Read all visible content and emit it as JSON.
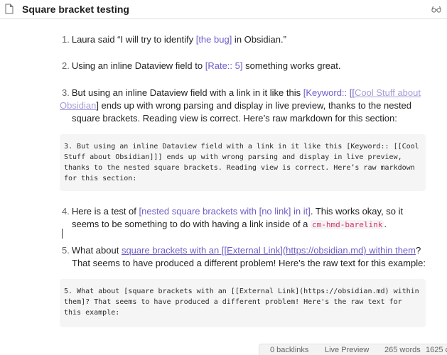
{
  "header": {
    "title": "Square bracket testing",
    "doc_icon": "file-icon",
    "mode_icon": "reading-glasses-icon"
  },
  "items": [
    {
      "num": "1.",
      "before": "Laura said “I will try to identify ",
      "tag": "[the bug]",
      "after": " in Obsidian.”"
    },
    {
      "num": "2.",
      "before": "Using an inline Dataview field to ",
      "tag": "[Rate:: 5]",
      "after": " something works great."
    },
    {
      "num": "3.",
      "line1_before": "But using an inline Dataview field with a link in it like this ",
      "line1_tag": "[Keyword:: [[",
      "line1_link": "Cool Stuff about",
      "line2_link": "Obsidian",
      "line2_after": "] ends up with wrong parsing and display in live preview, thanks to the nested",
      "line3": "square brackets. Reading view is correct. Here’s raw markdown for this section:"
    },
    {
      "num": "4.",
      "line1_before": "Here is a test of ",
      "line1_tag": "[nested square brackets with [no link] in it]",
      "line1_after": ". This works okay, so it",
      "line2_before": "seems to be something to do with having a link inside of a ",
      "line2_code": "cm-hmd-barelink",
      "line2_after": "."
    },
    {
      "num": "5.",
      "line1_before": "What about ",
      "line1_link": "square brackets with an [[External Link](https://obsidian.md) within them",
      "line1_after": "?",
      "line2": "That seems to have produced a different problem! Here's the raw text for this example:"
    }
  ],
  "code_blocks": [
    "3. But using an inline Dataview field with a link in it like this [Keyword:: [[Cool\nStuff about Obsidian]]] ends up with wrong parsing and display in live preview,\nthanks to the nested square brackets. Reading view is correct. Here’s raw markdown\nfor this section:",
    "5. What about [square brackets with an [[External Link](https://obsidian.md) within\nthem]? That seems to have produced a different problem! Here's the raw text for\nthis example:"
  ],
  "status": {
    "backlinks": "0 backlinks",
    "mode": "Live Preview",
    "words": "265 words",
    "chars": "1625 c"
  }
}
